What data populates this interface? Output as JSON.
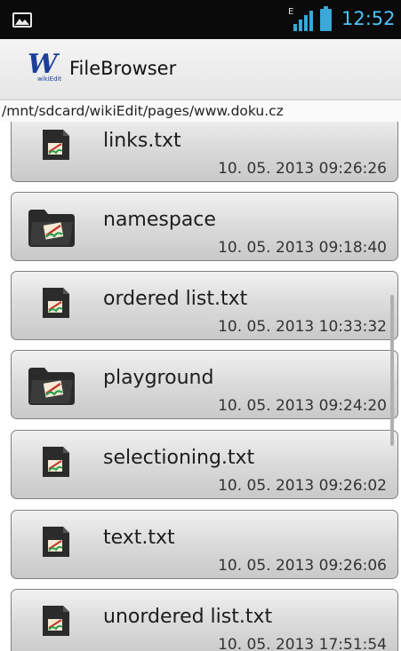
{
  "status_bar": {
    "network_label": "E",
    "time": "12:52",
    "accent_color": "#4fc3f7"
  },
  "app": {
    "logo_letter": "W",
    "logo_sub": "wikiEdit",
    "title": "FileBrowser"
  },
  "path": "/mnt/sdcard/wikiEdit/pages/www.doku.cz",
  "items": [
    {
      "name": "links.txt",
      "date": "10. 05. 2013 09:26:26",
      "type": "file-icon"
    },
    {
      "name": "namespace",
      "date": "10. 05. 2013 09:18:40",
      "type": "folder-icon"
    },
    {
      "name": "ordered list.txt",
      "date": "10. 05. 2013 10:33:32",
      "type": "file-icon"
    },
    {
      "name": "playground",
      "date": "10. 05. 2013 09:24:20",
      "type": "folder-icon"
    },
    {
      "name": "selectioning.txt",
      "date": "10. 05. 2013 09:26:02",
      "type": "file-icon"
    },
    {
      "name": "text.txt",
      "date": "10. 05. 2013 09:26:06",
      "type": "file-icon"
    },
    {
      "name": "unordered list.txt",
      "date": "10. 05. 2013 17:51:54",
      "type": "file-icon"
    }
  ]
}
